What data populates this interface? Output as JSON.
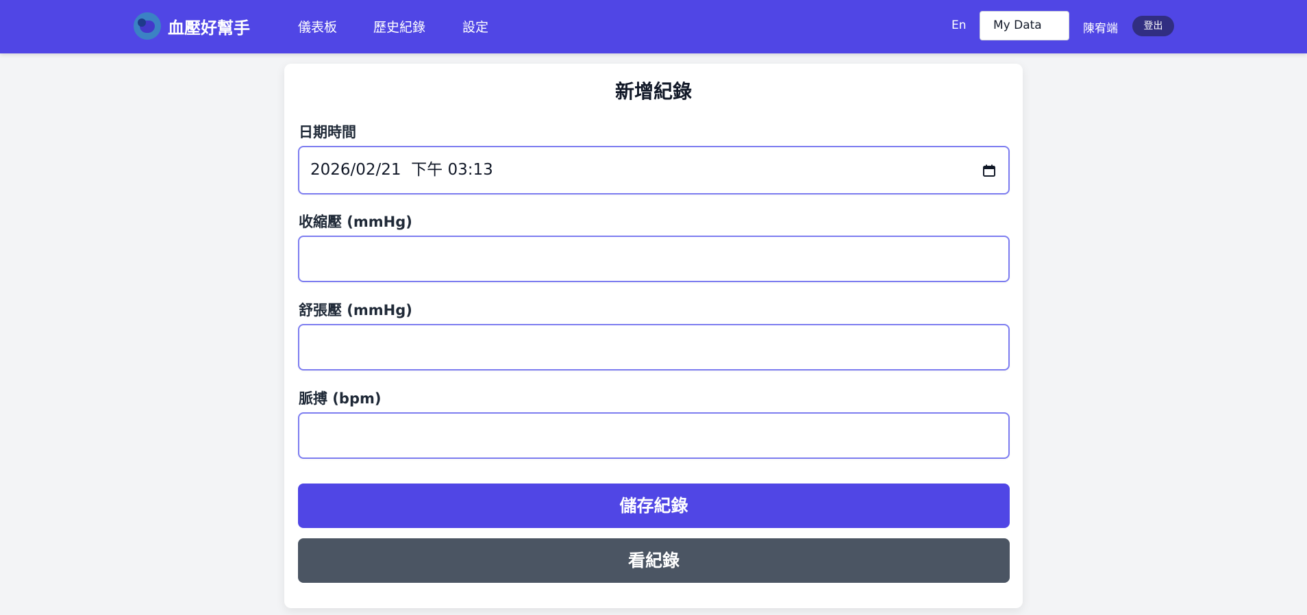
{
  "app": {
    "name": "血壓好幫手"
  },
  "nav": {
    "links": [
      "儀表板",
      "歷史紀錄",
      "設定"
    ],
    "language": "En",
    "data_select": "My Data",
    "user": "陳宥端",
    "logout": "登出"
  },
  "form": {
    "title": "新增紀錄",
    "datetime": {
      "label": "日期時間",
      "value": "2026/02/21  下午 03:13"
    },
    "systolic": {
      "label": "收縮壓 (mmHg)",
      "value": ""
    },
    "diastolic": {
      "label": "舒張壓 (mmHg)",
      "value": ""
    },
    "pulse": {
      "label": "脈搏 (bpm)",
      "value": ""
    },
    "save_label": "儲存紀錄",
    "view_label": "看紀錄"
  },
  "colors": {
    "primary": "#5046e5",
    "secondary": "#4b5563",
    "background": "#f3f4f6",
    "input_border": "#7c7cf0",
    "logout_bg": "#312e81"
  },
  "icons": {
    "logo": "blood-pressure-logo-icon",
    "datetime_picker": "calendar-icon"
  }
}
